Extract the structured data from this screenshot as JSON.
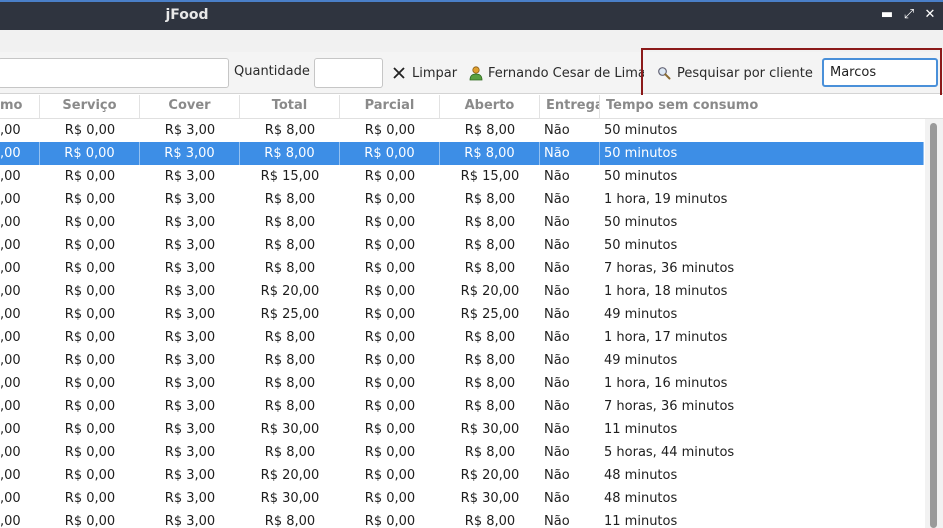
{
  "window": {
    "title": "jFood",
    "controls": {
      "minimize": "▬",
      "maximize": "⤢",
      "close": "✕"
    }
  },
  "toolbar": {
    "quantity_label": "Quantidade",
    "clear_label": "Limpar",
    "user_label": "Fernando Cesar de Lima",
    "search_label": "Pesquisar por cliente",
    "client_search_value": "Marcos",
    "icons": {
      "clear": "close-icon",
      "user": "user-icon",
      "search": "magnifier-icon"
    }
  },
  "table": {
    "columns": [
      "mo",
      "Serviço",
      "Cover",
      "Total",
      "Parcial",
      "Aberto",
      "Entrega",
      "Tempo sem consumo"
    ],
    "selected_row": 1,
    "rows": [
      [
        ",00",
        "R$ 0,00",
        "R$ 3,00",
        "R$ 8,00",
        "R$ 0,00",
        "R$ 8,00",
        "Não",
        "50 minutos"
      ],
      [
        ",00",
        "R$ 0,00",
        "R$ 3,00",
        "R$ 8,00",
        "R$ 0,00",
        "R$ 8,00",
        "Não",
        "50 minutos"
      ],
      [
        ",00",
        "R$ 0,00",
        "R$ 3,00",
        "R$ 15,00",
        "R$ 0,00",
        "R$ 15,00",
        "Não",
        "50 minutos"
      ],
      [
        ",00",
        "R$ 0,00",
        "R$ 3,00",
        "R$ 8,00",
        "R$ 0,00",
        "R$ 8,00",
        "Não",
        "1 hora, 19 minutos"
      ],
      [
        ",00",
        "R$ 0,00",
        "R$ 3,00",
        "R$ 8,00",
        "R$ 0,00",
        "R$ 8,00",
        "Não",
        "50 minutos"
      ],
      [
        ",00",
        "R$ 0,00",
        "R$ 3,00",
        "R$ 8,00",
        "R$ 0,00",
        "R$ 8,00",
        "Não",
        "50 minutos"
      ],
      [
        ",00",
        "R$ 0,00",
        "R$ 3,00",
        "R$ 8,00",
        "R$ 0,00",
        "R$ 8,00",
        "Não",
        "7 horas, 36 minutos"
      ],
      [
        ",00",
        "R$ 0,00",
        "R$ 3,00",
        "R$ 20,00",
        "R$ 0,00",
        "R$ 20,00",
        "Não",
        "1 hora, 18 minutos"
      ],
      [
        ",00",
        "R$ 0,00",
        "R$ 3,00",
        "R$ 25,00",
        "R$ 0,00",
        "R$ 25,00",
        "Não",
        "49 minutos"
      ],
      [
        ",00",
        "R$ 0,00",
        "R$ 3,00",
        "R$ 8,00",
        "R$ 0,00",
        "R$ 8,00",
        "Não",
        "1 hora, 17 minutos"
      ],
      [
        ",00",
        "R$ 0,00",
        "R$ 3,00",
        "R$ 8,00",
        "R$ 0,00",
        "R$ 8,00",
        "Não",
        "49 minutos"
      ],
      [
        ",00",
        "R$ 0,00",
        "R$ 3,00",
        "R$ 8,00",
        "R$ 0,00",
        "R$ 8,00",
        "Não",
        "1 hora, 16 minutos"
      ],
      [
        ",00",
        "R$ 0,00",
        "R$ 3,00",
        "R$ 8,00",
        "R$ 0,00",
        "R$ 8,00",
        "Não",
        "7 horas, 36 minutos"
      ],
      [
        ",00",
        "R$ 0,00",
        "R$ 3,00",
        "R$ 30,00",
        "R$ 0,00",
        "R$ 30,00",
        "Não",
        "11 minutos"
      ],
      [
        ",00",
        "R$ 0,00",
        "R$ 3,00",
        "R$ 8,00",
        "R$ 0,00",
        "R$ 8,00",
        "Não",
        "5 horas, 44 minutos"
      ],
      [
        ",00",
        "R$ 0,00",
        "R$ 3,00",
        "R$ 20,00",
        "R$ 0,00",
        "R$ 20,00",
        "Não",
        "48 minutos"
      ],
      [
        ",00",
        "R$ 0,00",
        "R$ 3,00",
        "R$ 30,00",
        "R$ 0,00",
        "R$ 30,00",
        "Não",
        "48 minutos"
      ],
      [
        ",00",
        "R$ 0,00",
        "R$ 3,00",
        "R$ 8,00",
        "R$ 0,00",
        "R$ 8,00",
        "Não",
        "11 minutos"
      ]
    ]
  },
  "colors": {
    "titlebar": "#2f343f",
    "selection": "#3d8ee6",
    "highlight_border": "#8b1a1a",
    "focus_border": "#4a90d9"
  }
}
